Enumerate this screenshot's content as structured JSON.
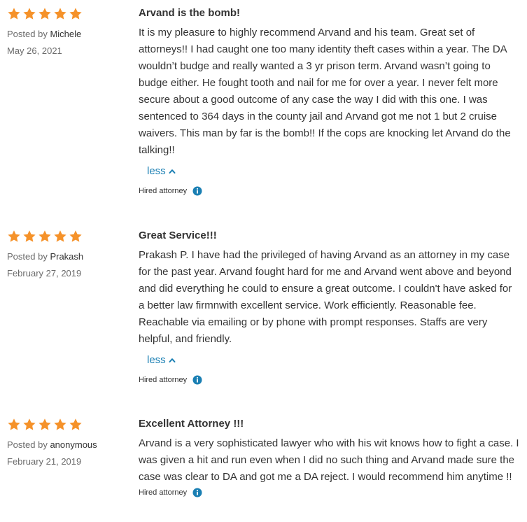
{
  "colors": {
    "star": "#f5922a",
    "link": "#1a7fb3",
    "info_icon": "#1a7fb3"
  },
  "reviews": [
    {
      "rating": 5,
      "posted_prefix": "Posted by",
      "author": "Michele",
      "date": "May 26, 2021",
      "title": "Arvand is the bomb!",
      "body": "It is my pleasure to highly recommend Arvand and his team. Great set of attorneys!! I had caught one too many identity theft cases within a year. The DA wouldn’t budge and really wanted a 3 yr prison term. Arvand wasn’t going to budge either. He fought tooth and nail for me for over a year. I never felt more secure about a good outcome of any case the way I did with this one. I was sentenced to 364 days in the county jail and Arvand got me not 1 but 2 cruise waivers. This man by far is the bomb!! If the cops are knocking let Arvand do the talking!!",
      "toggle_label": "less",
      "hired_label": "Hired attorney"
    },
    {
      "rating": 5,
      "posted_prefix": "Posted by",
      "author": "Prakash",
      "date": "February 27, 2019",
      "title": "Great Service!!!",
      "body": "Prakash P. I have had the privileged of having Arvand as an attorney in my case for the past year. Arvand fought hard for me and Arvand went above and beyond and did everything he could to ensure a great outcome. I couldn't have asked for a better law firmnwith excellent service. Work efficiently. Reasonable fee. Reachable via emailing or by phone with prompt responses. Staffs are very helpful, and friendly.",
      "toggle_label": "less",
      "hired_label": "Hired attorney"
    },
    {
      "rating": 5,
      "posted_prefix": "Posted by",
      "author": "anonymous",
      "date": "February 21, 2019",
      "title": "Excellent Attorney !!!",
      "body": "Arvand is a very sophisticated lawyer who with his wit knows how to fight a case. I was given a hit and run even when I did no such thing and Arvand made sure the case was clear to DA and got me a DA reject. I would recommend him anytime !!",
      "toggle_label": "",
      "hired_label": "Hired attorney"
    }
  ]
}
